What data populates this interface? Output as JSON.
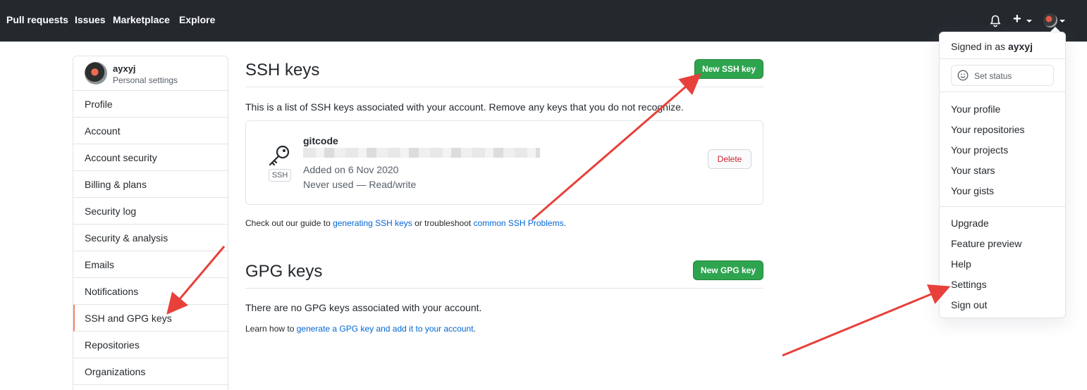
{
  "nav": {
    "links": [
      "Pull requests",
      "Issues",
      "Marketplace",
      "Explore"
    ]
  },
  "icons": {
    "bell": "bell-icon",
    "plus": "plus-icon",
    "avatar": "avatar",
    "key": "key-icon",
    "smiley": "smiley-icon"
  },
  "sidebar": {
    "username": "ayxyj",
    "subtitle": "Personal settings",
    "items": [
      "Profile",
      "Account",
      "Account security",
      "Billing & plans",
      "Security log",
      "Security & analysis",
      "Emails",
      "Notifications",
      "SSH and GPG keys",
      "Repositories",
      "Organizations"
    ],
    "selected_index": 8
  },
  "ssh": {
    "title": "SSH keys",
    "new_button": "New SSH key",
    "intro": "This is a list of SSH keys associated with your account. Remove any keys that you do not recognize.",
    "key": {
      "name": "gitcode",
      "badge": "SSH",
      "added": "Added on 6 Nov 2020",
      "usage": "Never used — Read/write",
      "delete_label": "Delete"
    },
    "guide_prefix": "Check out our guide to ",
    "guide_link1": "generating SSH keys",
    "guide_mid": " or troubleshoot ",
    "guide_link2": "common SSH Problems",
    "guide_suffix": "."
  },
  "gpg": {
    "title": "GPG keys",
    "new_button": "New GPG key",
    "empty": "There are no GPG keys associated with your account.",
    "learn_prefix": "Learn how to ",
    "learn_link": "generate a GPG key and add it to your account",
    "learn_suffix": "."
  },
  "dropdown": {
    "signed_prefix": "Signed in as ",
    "signed_user": "ayxyj",
    "set_status": "Set status",
    "group1": [
      "Your profile",
      "Your repositories",
      "Your projects",
      "Your stars",
      "Your gists"
    ],
    "group2": [
      "Upgrade",
      "Feature preview",
      "Help",
      "Settings",
      "Sign out"
    ]
  },
  "colors": {
    "header_bg": "#24292e",
    "green": "#2ea44f",
    "link": "#0366d6",
    "danger": "#cb2431",
    "selected_border": "#f9826c",
    "annotation_arrow": "#e8403a"
  }
}
